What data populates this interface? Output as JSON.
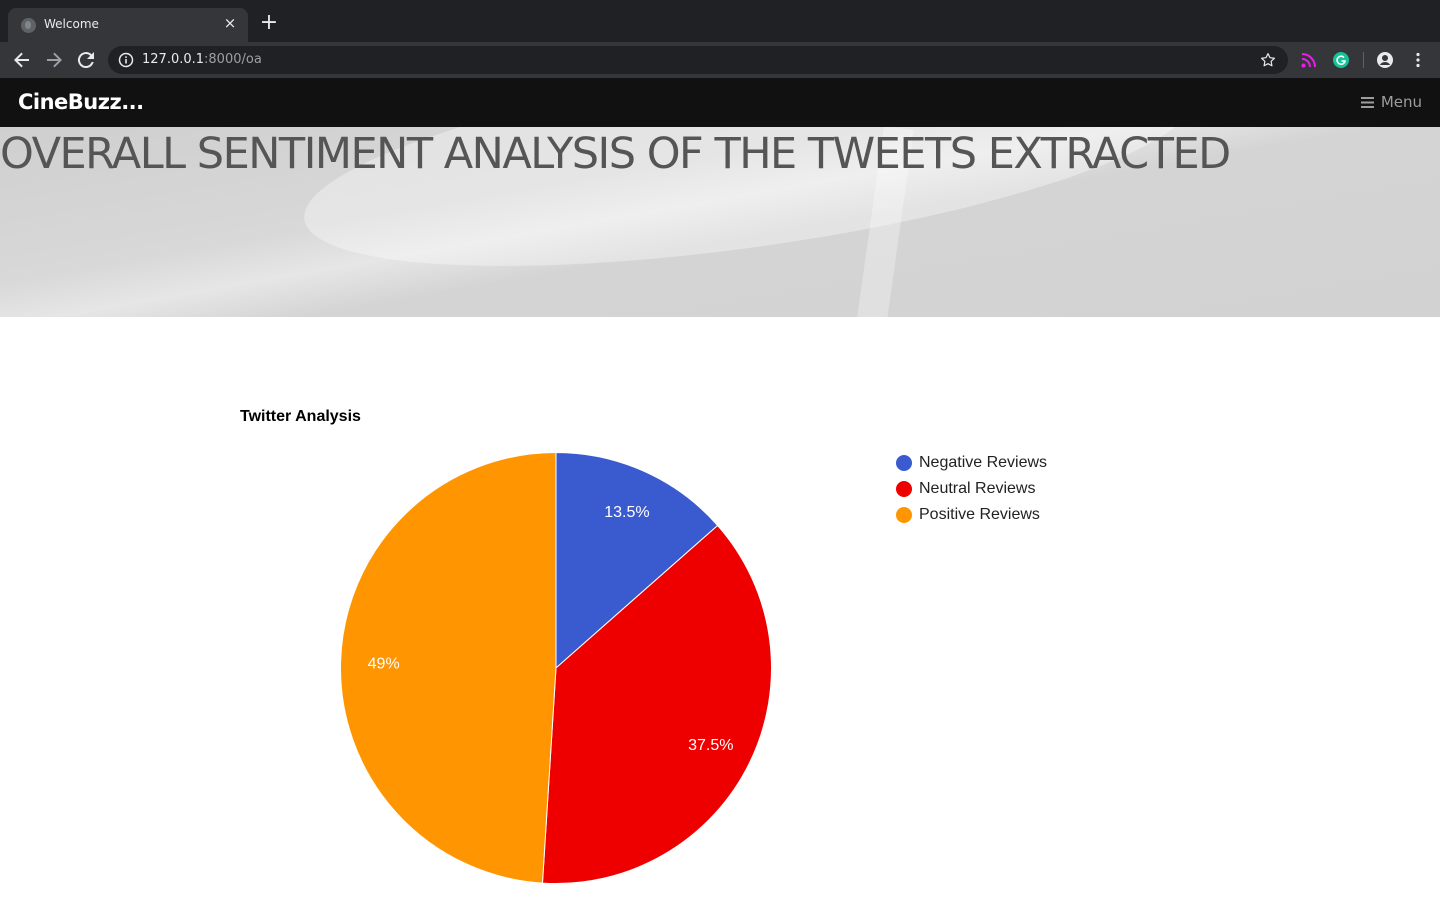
{
  "browser": {
    "tab_title": "Welcome",
    "tab_close": "×",
    "new_tab": "+",
    "url_host": "127.0.0.1",
    "url_path": ":8000/oa"
  },
  "site": {
    "brand": "CineBuzz...",
    "menu_label": "Menu"
  },
  "header": {
    "title": "OVERALL SENTIMENT ANALYSIS OF THE TWEETS EXTRACTED"
  },
  "colors": {
    "negative": "#3a5bcf",
    "neutral": "#ee0000",
    "positive": "#ff9500"
  },
  "chart_data": {
    "type": "pie",
    "title": "Twitter Analysis",
    "slices": [
      {
        "label": "Negative Reviews",
        "value": 13.5,
        "display": "13.5%",
        "color": "#3a5bcf"
      },
      {
        "label": "Neutral Reviews",
        "value": 37.5,
        "display": "37.5%",
        "color": "#ee0000"
      },
      {
        "label": "Positive Reviews",
        "value": 49,
        "display": "49%",
        "color": "#ff9500"
      }
    ],
    "legend_position": "right"
  }
}
